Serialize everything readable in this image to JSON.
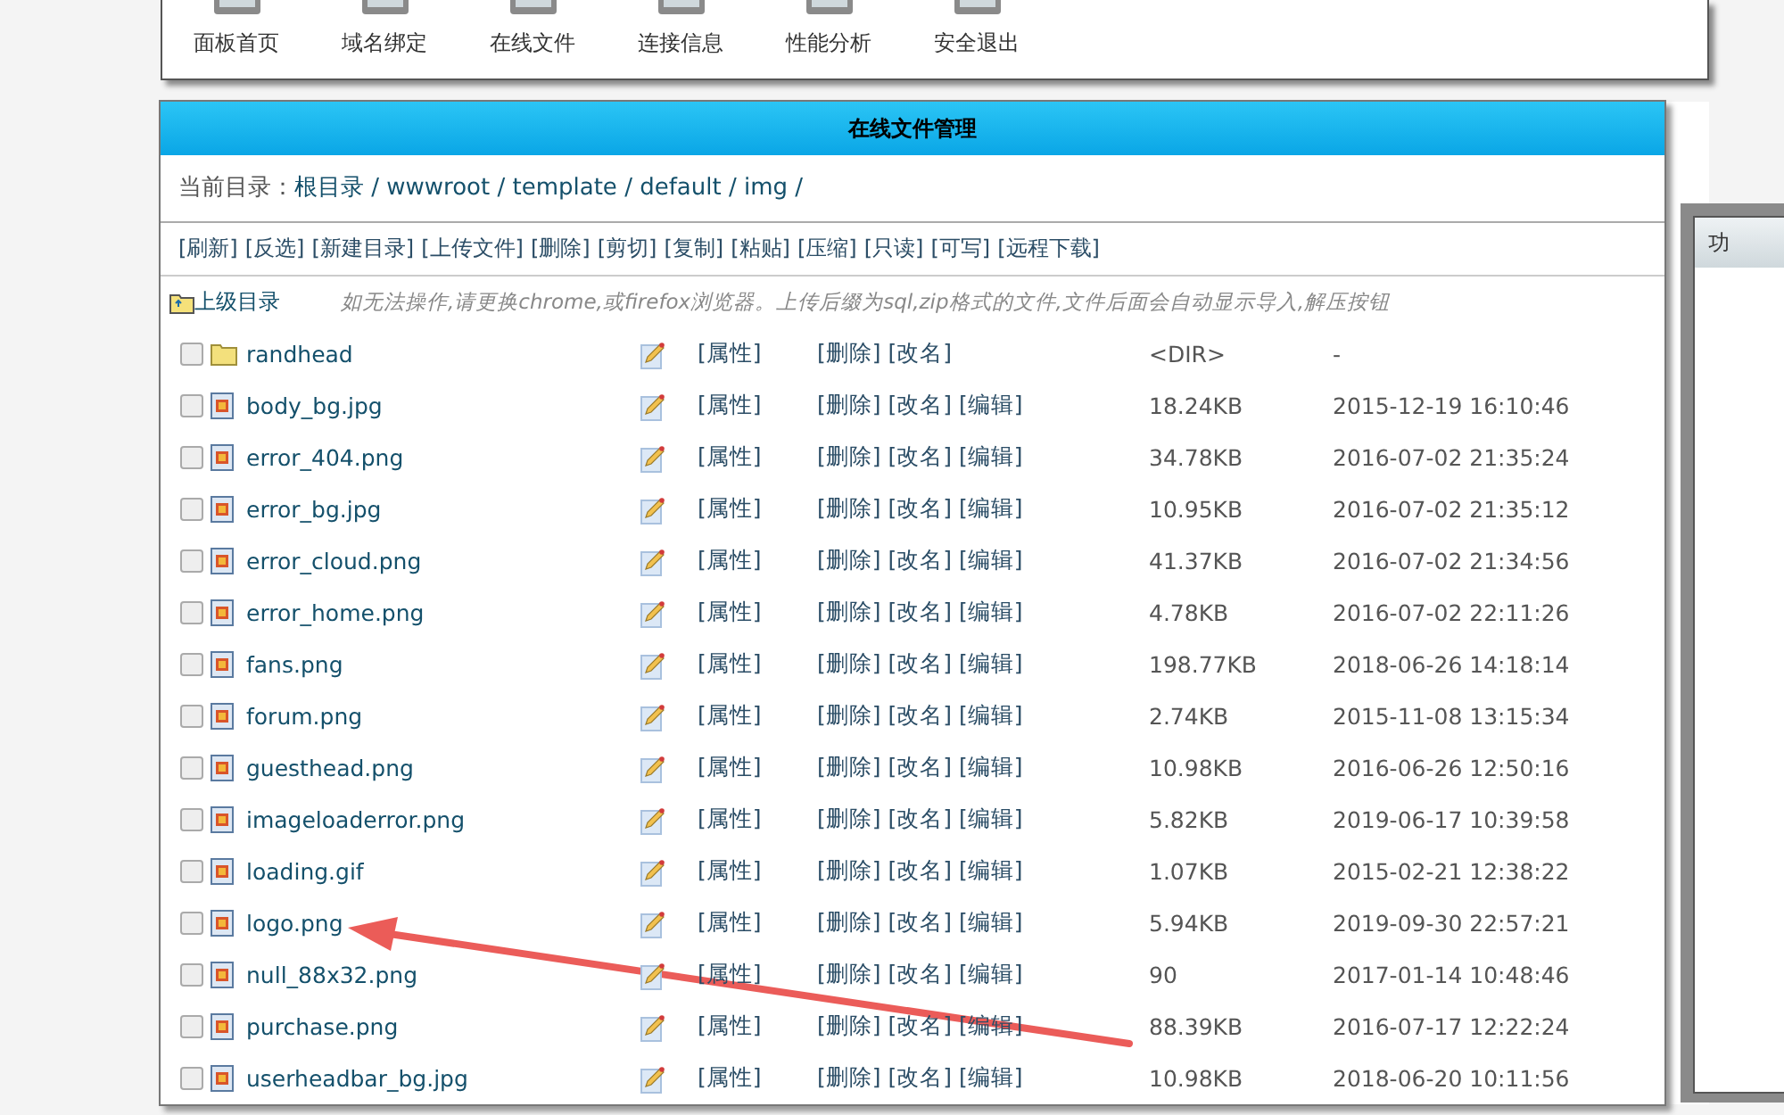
{
  "toolbar": [
    {
      "label": "面板首页"
    },
    {
      "label": "域名绑定"
    },
    {
      "label": "在线文件"
    },
    {
      "label": "连接信息"
    },
    {
      "label": "性能分析"
    },
    {
      "label": "安全退出"
    }
  ],
  "panel": {
    "title": "在线文件管理",
    "current_dir_label": "当前目录：",
    "current_dir_path": "根目录 / wwwroot / template / default / img /",
    "actions": [
      "[刷新]",
      "[反选]",
      "[新建目录]",
      "[上传文件]",
      "[删除]",
      "[剪切]",
      "[复制]",
      "[粘贴]",
      "[压缩]",
      "[只读]",
      "[可写]",
      "[远程下载]"
    ],
    "parent_link": "上级目录",
    "notice": "如无法操作,请更换chrome,或firefox浏览器。上传后缀为sql,zip格式的文件,文件后面会自动显示导入,解压按钮",
    "rows": [
      {
        "kind": "folder",
        "checked": false,
        "name": "randhead",
        "actions": [
          "[属性]",
          "[删除]",
          "[改名]"
        ],
        "size": "<DIR>",
        "date": "-"
      },
      {
        "kind": "file",
        "checked": false,
        "name": "body_bg.jpg",
        "actions": [
          "[属性]",
          "[删除]",
          "[改名]",
          "[编辑]"
        ],
        "size": "18.24KB",
        "date": "2015-12-19 16:10:46"
      },
      {
        "kind": "file",
        "checked": false,
        "name": "error_404.png",
        "actions": [
          "[属性]",
          "[删除]",
          "[改名]",
          "[编辑]"
        ],
        "size": "34.78KB",
        "date": "2016-07-02 21:35:24"
      },
      {
        "kind": "file",
        "checked": false,
        "name": "error_bg.jpg",
        "actions": [
          "[属性]",
          "[删除]",
          "[改名]",
          "[编辑]"
        ],
        "size": "10.95KB",
        "date": "2016-07-02 21:35:12"
      },
      {
        "kind": "file",
        "checked": false,
        "name": "error_cloud.png",
        "actions": [
          "[属性]",
          "[删除]",
          "[改名]",
          "[编辑]"
        ],
        "size": "41.37KB",
        "date": "2016-07-02 21:34:56"
      },
      {
        "kind": "file",
        "checked": false,
        "name": "error_home.png",
        "actions": [
          "[属性]",
          "[删除]",
          "[改名]",
          "[编辑]"
        ],
        "size": "4.78KB",
        "date": "2016-07-02 22:11:26"
      },
      {
        "kind": "file",
        "checked": false,
        "name": "fans.png",
        "actions": [
          "[属性]",
          "[删除]",
          "[改名]",
          "[编辑]"
        ],
        "size": "198.77KB",
        "date": "2018-06-26 14:18:14"
      },
      {
        "kind": "file",
        "checked": false,
        "name": "forum.png",
        "actions": [
          "[属性]",
          "[删除]",
          "[改名]",
          "[编辑]"
        ],
        "size": "2.74KB",
        "date": "2015-11-08 13:15:34"
      },
      {
        "kind": "file",
        "checked": false,
        "name": "guesthead.png",
        "actions": [
          "[属性]",
          "[删除]",
          "[改名]",
          "[编辑]"
        ],
        "size": "10.98KB",
        "date": "2016-06-26 12:50:16"
      },
      {
        "kind": "file",
        "checked": false,
        "name": "imageloaderror.png",
        "actions": [
          "[属性]",
          "[删除]",
          "[改名]",
          "[编辑]"
        ],
        "size": "5.82KB",
        "date": "2019-06-17 10:39:58"
      },
      {
        "kind": "file",
        "checked": false,
        "name": "loading.gif",
        "actions": [
          "[属性]",
          "[删除]",
          "[改名]",
          "[编辑]"
        ],
        "size": "1.07KB",
        "date": "2015-02-21 12:38:22"
      },
      {
        "kind": "file",
        "checked": false,
        "name": "logo.png",
        "actions": [
          "[属性]",
          "[删除]",
          "[改名]",
          "[编辑]"
        ],
        "size": "5.94KB",
        "date": "2019-09-30 22:57:21"
      },
      {
        "kind": "file",
        "checked": false,
        "name": "null_88x32.png",
        "actions": [
          "[属性]",
          "[删除]",
          "[改名]",
          "[编辑]"
        ],
        "size": "90",
        "date": "2017-01-14 10:48:46"
      },
      {
        "kind": "file",
        "checked": false,
        "name": "purchase.png",
        "actions": [
          "[属性]",
          "[删除]",
          "[改名]",
          "[编辑]"
        ],
        "size": "88.39KB",
        "date": "2016-07-17 12:22:24"
      },
      {
        "kind": "file",
        "checked": false,
        "name": "userheadbar_bg.jpg",
        "actions": [
          "[属性]",
          "[删除]",
          "[改名]",
          "[编辑]"
        ],
        "size": "10.98KB",
        "date": "2018-06-20 10:11:56"
      }
    ]
  },
  "side_panel": {
    "header": "功"
  }
}
